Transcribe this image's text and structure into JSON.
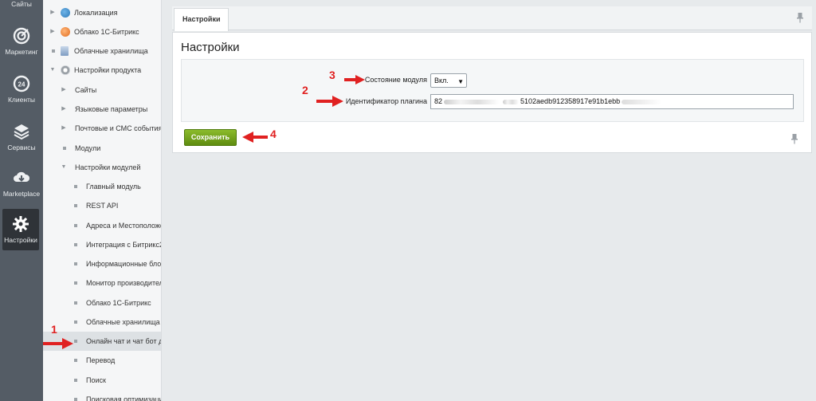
{
  "iconbar": {
    "top_label": "Сайты",
    "items": [
      {
        "label": "Маркетинг",
        "icon": "target-icon"
      },
      {
        "label": "Клиенты",
        "icon": "clients-24-icon"
      },
      {
        "label": "Сервисы",
        "icon": "layers-icon"
      },
      {
        "label": "Marketplace",
        "icon": "cloud-download-icon"
      },
      {
        "label": "Настройки",
        "icon": "gear-icon"
      }
    ]
  },
  "tree": {
    "items": [
      {
        "label": "Локализация"
      },
      {
        "label": "Облако 1С-Битрикс"
      },
      {
        "label": "Облачные хранилища"
      },
      {
        "label": "Настройки продукта"
      },
      {
        "label": "Сайты"
      },
      {
        "label": "Языковые параметры"
      },
      {
        "label": "Почтовые и СМС события"
      },
      {
        "label": "Модули"
      },
      {
        "label": "Настройки модулей"
      },
      {
        "label": "Главный модуль"
      },
      {
        "label": "REST API"
      },
      {
        "label": "Адреса и Местоположе"
      },
      {
        "label": "Интеграция с Битрикс2"
      },
      {
        "label": "Информационные блок"
      },
      {
        "label": "Монитор производител"
      },
      {
        "label": "Облако 1С-Битрикс"
      },
      {
        "label": "Облачные хранилища"
      },
      {
        "label": "Онлайн чат и чат бот д"
      },
      {
        "label": "Перевод"
      },
      {
        "label": "Поиск"
      },
      {
        "label": "Поисковая оптимизация"
      }
    ]
  },
  "main": {
    "tab_label": "Настройки",
    "panel_title": "Настройки",
    "module_state_label": "Состояние модуля",
    "module_state_value": "Вкл.",
    "plugin_id_label": "Идентификатор плагина",
    "plugin_id_prefix": "82",
    "plugin_id_mid1": "5",
    "plugin_id_visible": "102aedb912358917e91b1ebb",
    "save_label": "Сохранить"
  },
  "annotations": {
    "n1": "1",
    "n2": "2",
    "n3": "3",
    "n4": "4"
  },
  "colors": {
    "annotation_red": "#e02121",
    "save_green": "#6f9c1a",
    "iconbar_bg": "#545c65"
  }
}
